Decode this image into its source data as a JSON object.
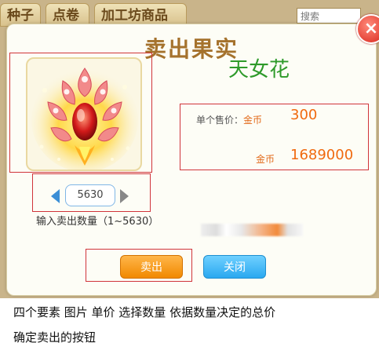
{
  "background_tabs": [
    "种子",
    "点卷",
    "加工坊商品"
  ],
  "search": {
    "placeholder": "搜索"
  },
  "dialog": {
    "title": "卖出果实",
    "close_icon": "×",
    "item_name": "天女花",
    "unit_price_label": "单个售价：",
    "coin_label": "金币",
    "unit_price": "300",
    "total_coin_label": "金币",
    "total_price": "1689000",
    "quantity": "5630",
    "quantity_hint": "输入卖出数量（1~5630）",
    "sell_button": "卖出",
    "close_button": "关闭"
  },
  "captions": {
    "line1": "四个要素 图片 单价 选择数量 依据数量决定的总价",
    "line2": "确定卖出的按钮"
  },
  "colors": {
    "accent": "#f18900",
    "annotation_box": "#d0343a",
    "item_name": "#2e9a2a"
  },
  "icons": [
    "flower-item-icon",
    "close-icon",
    "arrow-left-icon",
    "arrow-right-icon"
  ]
}
